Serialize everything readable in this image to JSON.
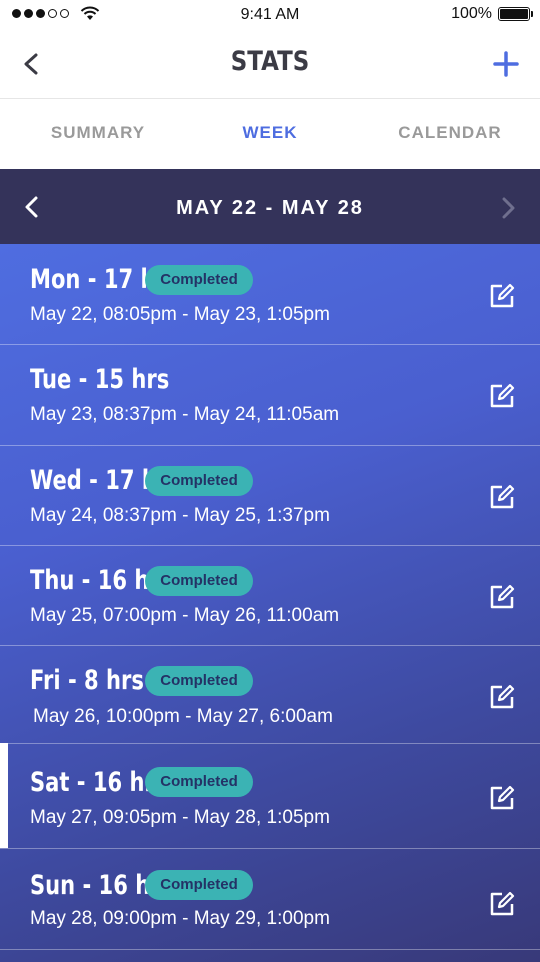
{
  "status_bar": {
    "time": "9:41 AM",
    "battery": "100%"
  },
  "nav": {
    "title": "STATS"
  },
  "tabs": [
    {
      "label": "SUMMARY",
      "active": false
    },
    {
      "label": "WEEK",
      "active": true
    },
    {
      "label": "CALENDAR",
      "active": false
    }
  ],
  "week": {
    "label": "MAY 22 - MAY 28"
  },
  "days": [
    {
      "title": "Mon - 17 hrs",
      "badge": "Completed",
      "range": "May 22, 08:05pm - May 23, 1:05pm"
    },
    {
      "title": "Tue - 15 hrs",
      "badge": "",
      "range": "May 23, 08:37pm - May 24, 11:05am"
    },
    {
      "title": "Wed - 17 hrs",
      "badge": "Completed",
      "range": "May 24, 08:37pm - May 25, 1:37pm"
    },
    {
      "title": "Thu - 16 hrs",
      "badge": "Completed",
      "range": "May 25, 07:00pm - May 26, 11:00am"
    },
    {
      "title": "Fri - 8 hrs",
      "badge": "Completed",
      "range": "May 26, 10:00pm - May 27, 6:00am"
    },
    {
      "title": "Sat - 16 hrs",
      "badge": "Completed",
      "range": "May 27, 09:05pm - May 28, 1:05pm",
      "selected": true
    },
    {
      "title": "Sun - 16 hrs",
      "badge": "Completed",
      "range": "May 28, 09:00pm - May 29, 1:00pm"
    }
  ],
  "colors": {
    "accent": "#4e6de0",
    "header_bg": "#34335a",
    "badge_bg": "#3bb3b4",
    "badge_text": "#243266"
  },
  "icons": {
    "nav_back": "chevron-left-icon",
    "nav_add": "plus-icon",
    "week_prev": "chevron-left-icon",
    "week_next": "chevron-right-icon",
    "row_edit": "edit-icon"
  }
}
